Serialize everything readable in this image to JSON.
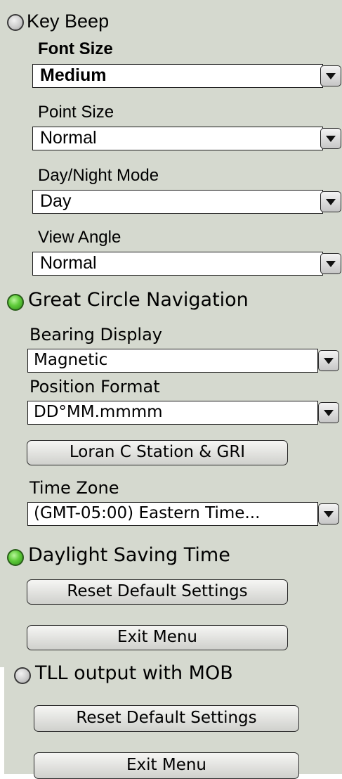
{
  "panel": {
    "key_beep": {
      "label": "Key Beep",
      "state": "off"
    },
    "font_size": {
      "label": "Font Size",
      "value": "Medium"
    },
    "point_size": {
      "label": "Point Size",
      "value": "Normal"
    },
    "day_night": {
      "label": "Day/Night Mode",
      "value": "Day"
    },
    "view_angle": {
      "label": "View Angle",
      "value": "Normal"
    },
    "great_circle": {
      "label": "Great Circle Navigation",
      "state": "on"
    },
    "bearing_display": {
      "label": "Bearing Display",
      "value": "Magnetic"
    },
    "position_format": {
      "label": "Position Format",
      "value": "DD°MM.mmmm"
    },
    "loran_button": "Loran C Station & GRI",
    "time_zone": {
      "label": "Time Zone",
      "value": "(GMT-05:00) Eastern Time..."
    },
    "daylight_saving": {
      "label": "Daylight Saving Time",
      "state": "on"
    },
    "reset_button_1": "Reset Default Settings",
    "exit_button_1": "Exit Menu",
    "tll_output": {
      "label": "TLL output with MOB",
      "state": "off"
    },
    "reset_button_2": "Reset Default Settings",
    "exit_button_2": "Exit Menu"
  },
  "colors": {
    "panel_background": "#d5d9cf",
    "led_on": "#5fcb3a",
    "led_off": "#c9c9c9"
  }
}
